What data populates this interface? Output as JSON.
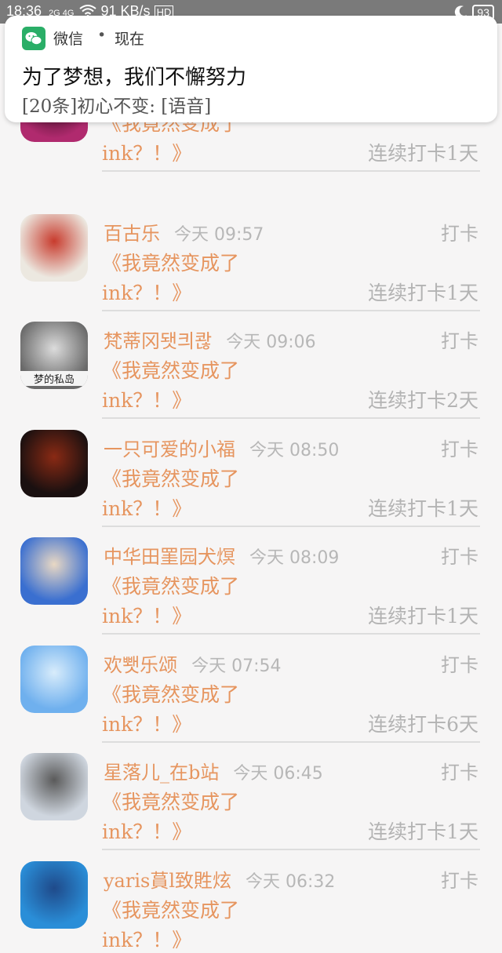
{
  "status_bar": {
    "time": "18:36",
    "signal": "2G 4G",
    "speed": "91 KB/s",
    "hd": "HD",
    "battery": "93"
  },
  "notification": {
    "app_name": "微信",
    "separator": "•",
    "time": "现在",
    "title": "为了梦想，我们不懈努力",
    "body": "[20条]初心不变: [语音]"
  },
  "entries": [
    {
      "name": "",
      "time": "",
      "action": "",
      "line1": "《我竟然变成了",
      "line2": "ink？！》",
      "streak": "连续打卡1天",
      "avatar_colors": [
        "#b02a6e",
        "#3a0c22"
      ]
    },
    {
      "name": "百古乐",
      "time": "今天 09:57",
      "action": "打卡",
      "line1": "《我竟然变成了",
      "line2": "ink？！》",
      "streak": "连续打卡1天",
      "avatar_colors": [
        "#ece8e0",
        "#c83b2d"
      ]
    },
    {
      "name": "梵蒂冈됏킈콶",
      "time": "今天 09:06",
      "action": "打卡",
      "line1": "《我竟然变成了",
      "line2": "ink？！》",
      "streak": "连续打卡2天",
      "avatar_colors": [
        "#6a6a6a",
        "#dcdcdc"
      ],
      "avatar_text": "梦的私岛"
    },
    {
      "name": "一只可爱的小福",
      "time": "今天 08:50",
      "action": "打卡",
      "line1": "《我竟然变成了",
      "line2": "ink？！》",
      "streak": "连续打卡1天",
      "avatar_colors": [
        "#1a1010",
        "#8a2a14"
      ]
    },
    {
      "name": "中华田罣园犬熐",
      "time": "今天 08:09",
      "action": "打卡",
      "line1": "《我竟然变成了",
      "line2": "ink？！》",
      "streak": "连续打卡1天",
      "avatar_colors": [
        "#3a6fd0",
        "#e9d8c4"
      ]
    },
    {
      "name": "欢뾋乐颂",
      "time": "今天 07:54",
      "action": "打卡",
      "line1": "《我竟然变成了",
      "line2": "ink？！》",
      "streak": "连续打卡6天",
      "avatar_colors": [
        "#6fb0ee",
        "#d8ecfb"
      ]
    },
    {
      "name": "星落儿_在b站",
      "time": "今天 06:45",
      "action": "打卡",
      "line1": "《我竟然变成了",
      "line2": "ink？！》",
      "streak": "连续打卡1天",
      "avatar_colors": [
        "#cfd6df",
        "#5a5a5a"
      ]
    },
    {
      "name": "yaris蒷l致貹炫",
      "time": "今天 06:32",
      "action": "打卡",
      "line1": "《我竟然变成了",
      "line2": "ink？！》",
      "streak": "",
      "avatar_colors": [
        "#2a8ed8",
        "#1f4a8a"
      ]
    }
  ]
}
